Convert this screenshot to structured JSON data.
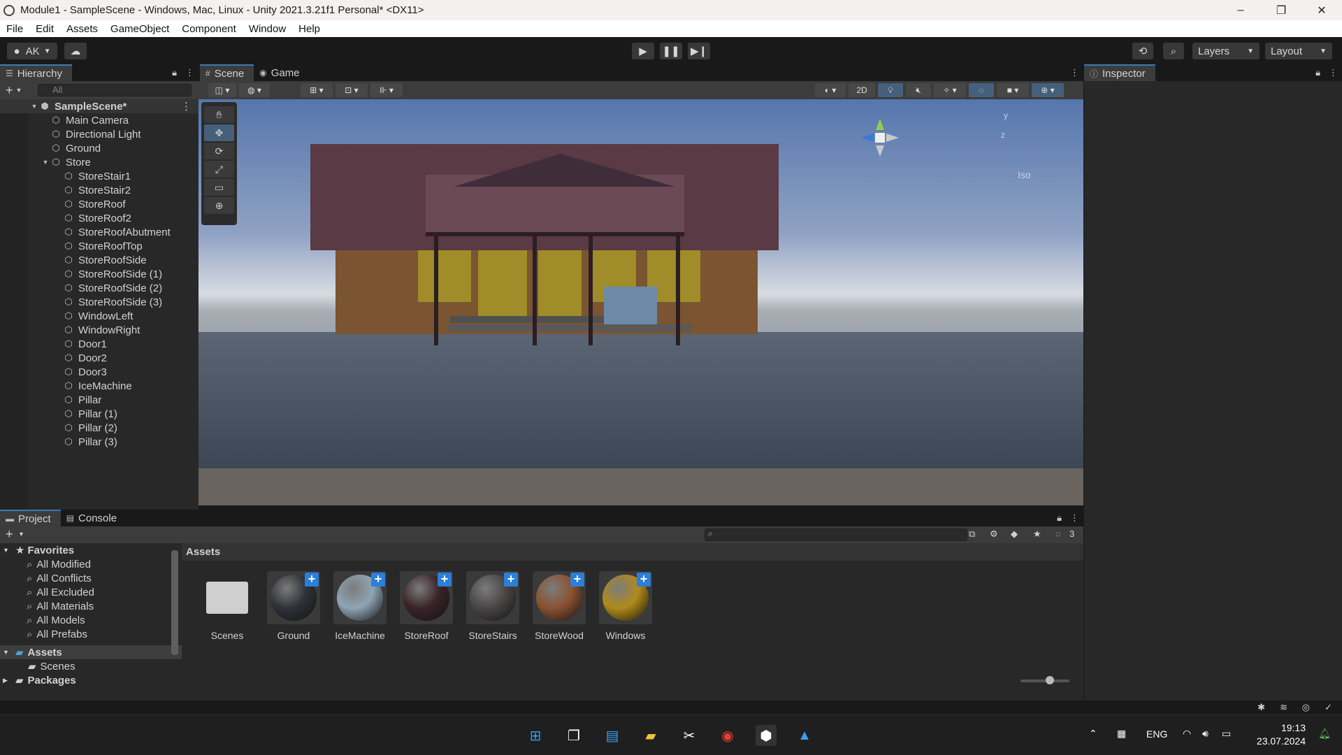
{
  "window": {
    "title": "Module1 - SampleScene - Windows, Mac, Linux - Unity 2021.3.21f1 Personal* <DX11>",
    "minimize": "–",
    "restore": "❐",
    "close": "✕"
  },
  "menu": [
    "File",
    "Edit",
    "Assets",
    "GameObject",
    "Component",
    "Window",
    "Help"
  ],
  "toolbar": {
    "account": "AK",
    "layers": "Layers",
    "layout": "Layout"
  },
  "hierarchy": {
    "tab": "Hierarchy",
    "search_placeholder": "All",
    "scene": "SampleScene*",
    "items": [
      {
        "label": "Main Camera",
        "level": 1
      },
      {
        "label": "Directional Light",
        "level": 1
      },
      {
        "label": "Ground",
        "level": 1
      },
      {
        "label": "Store",
        "level": 1,
        "expanded": true
      },
      {
        "label": "StoreStair1",
        "level": 2
      },
      {
        "label": "StoreStair2",
        "level": 2
      },
      {
        "label": "StoreRoof",
        "level": 2
      },
      {
        "label": "StoreRoof2",
        "level": 2
      },
      {
        "label": "StoreRoofAbutment",
        "level": 2
      },
      {
        "label": "StoreRoofTop",
        "level": 2
      },
      {
        "label": "StoreRoofSide",
        "level": 2
      },
      {
        "label": "StoreRoofSide (1)",
        "level": 2
      },
      {
        "label": "StoreRoofSide (2)",
        "level": 2
      },
      {
        "label": "StoreRoofSide (3)",
        "level": 2
      },
      {
        "label": "WindowLeft",
        "level": 2
      },
      {
        "label": "WindowRight",
        "level": 2
      },
      {
        "label": "Door1",
        "level": 2
      },
      {
        "label": "Door2",
        "level": 2
      },
      {
        "label": "Door3",
        "level": 2
      },
      {
        "label": "IceMachine",
        "level": 2
      },
      {
        "label": "Pillar",
        "level": 2
      },
      {
        "label": "Pillar (1)",
        "level": 2
      },
      {
        "label": "Pillar (2)",
        "level": 2
      },
      {
        "label": "Pillar (3)",
        "level": 2
      }
    ]
  },
  "scene": {
    "tabs": [
      "Scene",
      "Game"
    ],
    "toggle_2d": "2D",
    "gizmo": {
      "y": "y",
      "z": "z",
      "projection": "Iso"
    }
  },
  "inspector": {
    "tab": "Inspector"
  },
  "project": {
    "tabs": [
      "Project",
      "Console"
    ],
    "hidden_count": "3",
    "favorites_label": "Favorites",
    "favorites": [
      "All Modified",
      "All Conflicts",
      "All Excluded",
      "All Materials",
      "All Models",
      "All Prefabs"
    ],
    "assets_root": "Assets",
    "assets_children": [
      "Scenes"
    ],
    "packages": "Packages",
    "breadcrumb": "Assets",
    "assets": [
      {
        "name": "Scenes",
        "kind": "folder"
      },
      {
        "name": "Ground",
        "kind": "material",
        "color": "#2e3238"
      },
      {
        "name": "IceMachine",
        "kind": "material",
        "color": "#8fa4b4"
      },
      {
        "name": "StoreRoof",
        "kind": "material",
        "color": "#3a2428"
      },
      {
        "name": "StoreStairs",
        "kind": "material",
        "color": "#4a4646"
      },
      {
        "name": "StoreWood",
        "kind": "material",
        "color": "#8a5232"
      },
      {
        "name": "Windows",
        "kind": "material",
        "color": "#b08a1a"
      }
    ]
  },
  "taskbar": {
    "language": "ENG",
    "time": "19:13",
    "date": "23.07.2024"
  },
  "colors": {
    "accent": "#3a79bb",
    "sky_top": "#5a7bb0",
    "roof": "#5a3a44",
    "walls": "#7a5430",
    "windows": "#a08c28",
    "ice_machine": "#6d8ba8",
    "ground": "#4e5c6c"
  }
}
